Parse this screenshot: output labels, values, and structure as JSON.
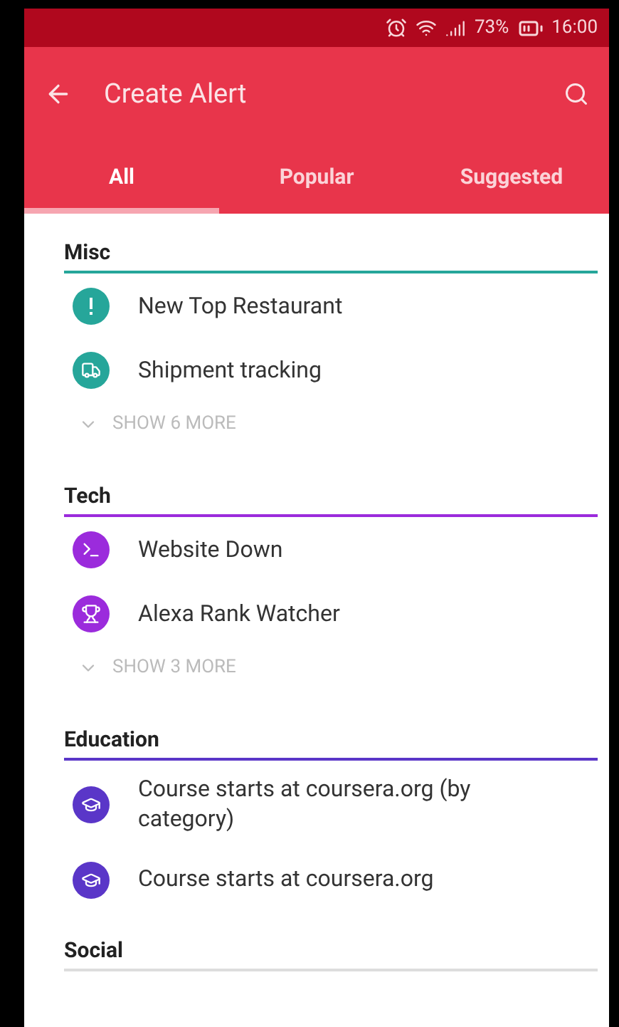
{
  "status_bar": {
    "battery": "73%",
    "time": "16:00"
  },
  "toolbar": {
    "title": "Create Alert"
  },
  "tabs": [
    {
      "label": "All",
      "selected": true
    },
    {
      "label": "Popular",
      "selected": false
    },
    {
      "label": "Suggested",
      "selected": false
    }
  ],
  "sections": [
    {
      "title": "Misc",
      "color": "#26a69a",
      "items": [
        {
          "label": "New Top Restaurant",
          "kind": "alert"
        },
        {
          "label": "Shipment tracking",
          "kind": "truck"
        }
      ],
      "show_more": "SHOW 6 MORE"
    },
    {
      "title": "Tech",
      "color": "#9b2bdc",
      "items": [
        {
          "label": "Website Down",
          "kind": "terminal"
        },
        {
          "label": "Alexa Rank Watcher",
          "kind": "trophy"
        }
      ],
      "show_more": "SHOW 3 MORE"
    },
    {
      "title": "Education",
      "color": "#5a36c8",
      "items": [
        {
          "label": "Course starts at coursera.org (by category)",
          "kind": "cap"
        },
        {
          "label": "Course starts at coursera.org",
          "kind": "cap"
        }
      ]
    },
    {
      "title": "Social"
    }
  ]
}
